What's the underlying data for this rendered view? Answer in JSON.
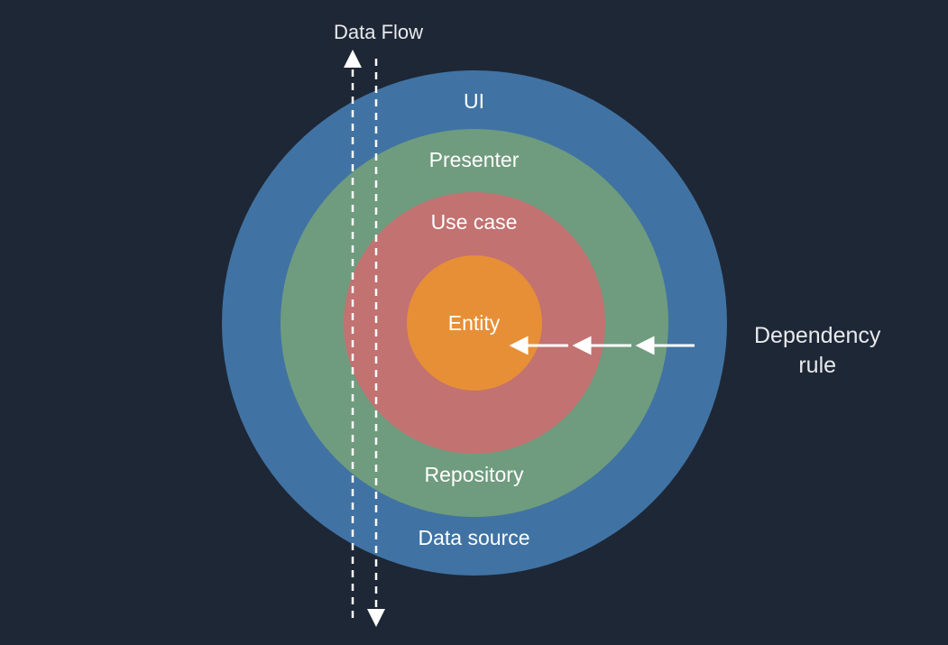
{
  "diagram": {
    "title": "Data Flow",
    "dependency_label_line1": "Dependency",
    "dependency_label_line2": "rule",
    "layers": {
      "ui_top": "UI",
      "presenter_top": "Presenter",
      "usecase_top": "Use case",
      "entity_center": "Entity",
      "repository_bottom": "Repository",
      "datasource_bottom": "Data source"
    }
  }
}
